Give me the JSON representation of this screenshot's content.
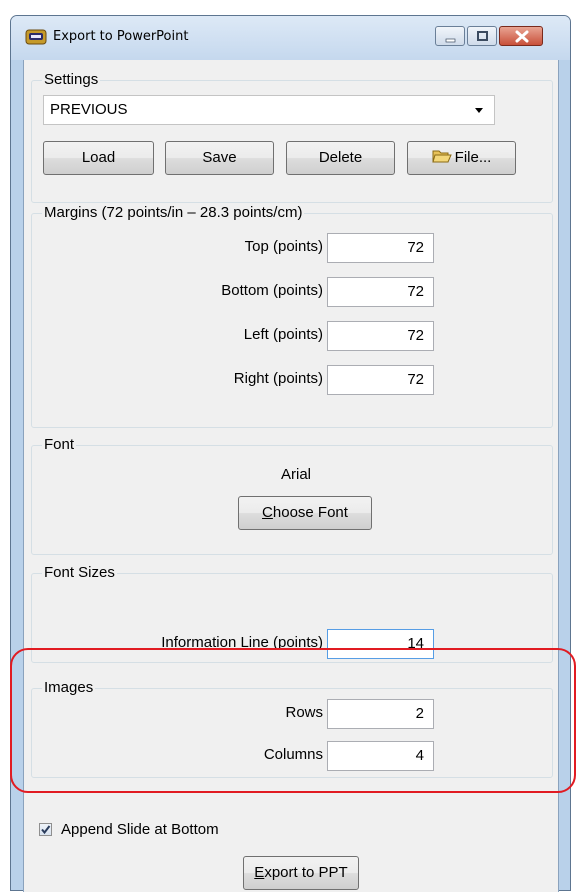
{
  "window": {
    "title": "Export to PowerPoint"
  },
  "settings": {
    "group_label": "Settings",
    "selected": "PREVIOUS",
    "load_label": "Load",
    "save_label": "Save",
    "delete_label": "Delete",
    "file_label": "File..."
  },
  "margins": {
    "group_label": "Margins   (72 points/in – 28.3 points/cm)",
    "fields": [
      {
        "label": "Top (points)",
        "value": "72"
      },
      {
        "label": "Bottom (points)",
        "value": "72"
      },
      {
        "label": "Left (points)",
        "value": "72"
      },
      {
        "label": "Right (points)",
        "value": "72"
      }
    ]
  },
  "font": {
    "group_label": "Font",
    "current": "Arial",
    "choose_prefix": "C",
    "choose_rest": "hoose Font"
  },
  "font_sizes": {
    "group_label": "Font Sizes",
    "info_line_label": "Information Line (points)",
    "info_line_value": "14"
  },
  "images": {
    "group_label": "Images",
    "rows_label": "Rows",
    "rows_value": "2",
    "columns_label": "Columns",
    "columns_value": "4"
  },
  "append": {
    "label": "Append Slide at Bottom",
    "checked": true
  },
  "export": {
    "prefix": "E",
    "rest": "xport to PPT"
  },
  "colors": {
    "highlight": "#e11b22",
    "focus_border": "#569de5"
  }
}
